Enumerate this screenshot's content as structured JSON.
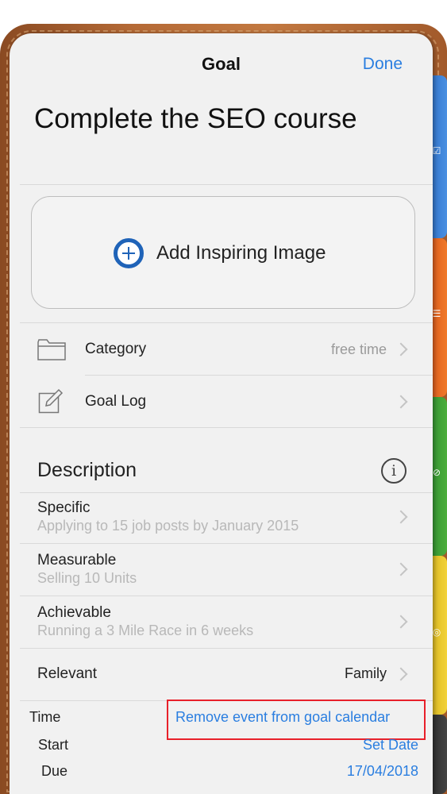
{
  "nav": {
    "title": "Goal",
    "done": "Done"
  },
  "goal": {
    "title": "Complete the SEO course"
  },
  "image": {
    "label": "Add Inspiring Image"
  },
  "rows": {
    "category": {
      "label": "Category",
      "value": "free time"
    },
    "goal_log": {
      "label": "Goal Log"
    }
  },
  "description": {
    "title": "Description",
    "info_glyph": "i",
    "items": [
      {
        "label": "Specific",
        "sub": "Applying to 15 job posts by January 2015"
      },
      {
        "label": "Measurable",
        "sub": "Selling 10 Units"
      },
      {
        "label": "Achievable",
        "sub": "Running a 3 Mile Race in 6 weeks"
      },
      {
        "label": "Relevant",
        "value": "Family"
      }
    ]
  },
  "time": {
    "label": "Time",
    "remove_link": "Remove event from goal calendar",
    "start_label": "Start",
    "start_value": "Set Date",
    "due_label": "Due",
    "due_value": "17/04/2018"
  },
  "colors": {
    "accent": "#2a7ee0",
    "plus_icon": "#1f63b8",
    "highlight": "#e8202a",
    "tabs": [
      "#4a90e2",
      "#f07a2a",
      "#4cae3c",
      "#f2d23a",
      "#333333"
    ]
  },
  "icons": [
    "folder-icon",
    "edit-icon",
    "plus-circle-icon",
    "info-icon",
    "chevron-right-icon"
  ]
}
